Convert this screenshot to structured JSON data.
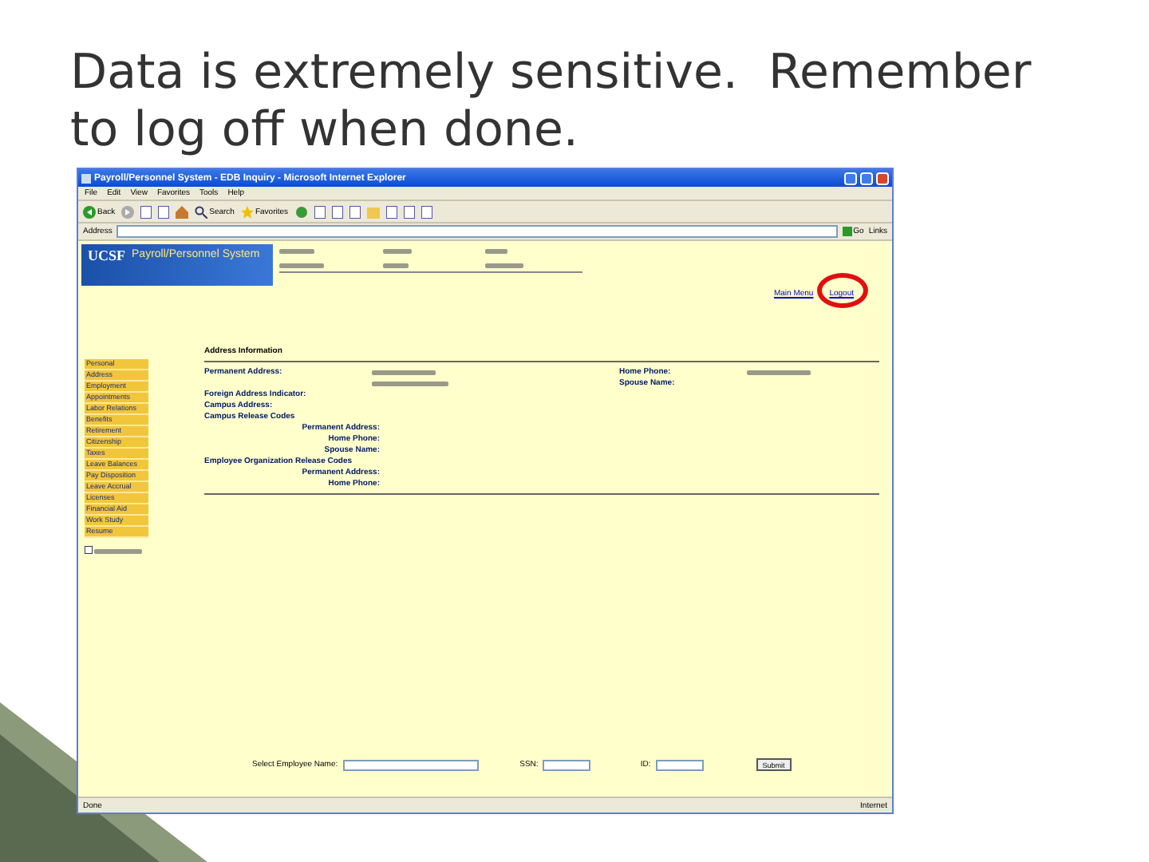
{
  "slide": {
    "heading": "Data is extremely sensitive.  Remember to log off when done."
  },
  "browser": {
    "title": "Payroll/Personnel System - EDB Inquiry - Microsoft Internet Explorer",
    "menu": [
      "File",
      "Edit",
      "View",
      "Favorites",
      "Tools",
      "Help"
    ],
    "toolbar": [
      {
        "kind": "back",
        "label": "Back"
      },
      {
        "kind": "forward"
      },
      {
        "kind": "page"
      },
      {
        "kind": "page"
      },
      {
        "kind": "home"
      },
      {
        "kind": "search",
        "label": "Search"
      },
      {
        "kind": "favorites",
        "label": "Favorites"
      },
      {
        "kind": "history"
      },
      {
        "kind": "page"
      },
      {
        "kind": "page"
      },
      {
        "kind": "page"
      },
      {
        "kind": "folder"
      },
      {
        "kind": "page"
      },
      {
        "kind": "page"
      },
      {
        "kind": "page"
      }
    ],
    "address": {
      "label": "Address",
      "go": "Go",
      "links": "Links"
    },
    "status": {
      "left": "Done",
      "right": "Internet"
    }
  },
  "page": {
    "logo": "UCSF",
    "system": "Payroll/Personnel System",
    "nav_links": [
      "Main Menu",
      "Logout"
    ],
    "sidebar": [
      "Personal",
      "Address",
      "Employment",
      "Appointments",
      "Labor Relations",
      "Benefits",
      "Retirement",
      "Citizenship",
      "Taxes",
      "Leave Balances",
      "Pay Disposition",
      "Leave Accrual",
      "Licenses",
      "Financial Aid",
      "Work Study",
      "Resume"
    ],
    "section_title": "Address Information",
    "rows": [
      {
        "kind": "field",
        "label": "Permanent Address:"
      },
      {
        "kind": "continued"
      },
      {
        "kind": "label",
        "label": "Foreign Address Indicator:"
      },
      {
        "kind": "label",
        "label": "Campus Address:"
      },
      {
        "kind": "label",
        "label": "Campus Release Codes"
      },
      {
        "kind": "indented",
        "label": "Permanent Address:"
      },
      {
        "kind": "indented",
        "label": "Home Phone:"
      },
      {
        "kind": "indented",
        "label": "Spouse Name:"
      },
      {
        "kind": "label",
        "label": "Employee Organization Release Codes"
      },
      {
        "kind": "indented",
        "label": "Permanent Address:"
      },
      {
        "kind": "indented",
        "label": "Home Phone:"
      }
    ],
    "right_rows": [
      {
        "kind": "field",
        "label": "Home Phone:"
      },
      {
        "kind": "label",
        "label": "Spouse Name:"
      }
    ],
    "search_form": {
      "name_label": "Select Employee Name:",
      "ssn_label": "SSN:",
      "id_label": "ID:",
      "button": "Submit"
    }
  }
}
